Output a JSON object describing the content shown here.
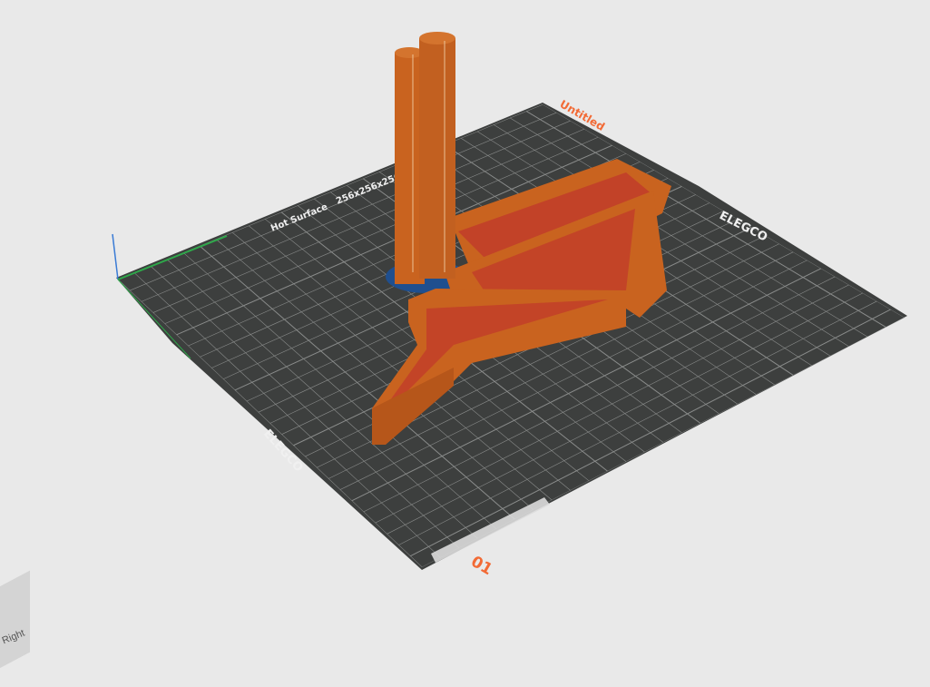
{
  "plate": {
    "name": "Untitled",
    "number": "01",
    "brand_logo": "ELEGCO",
    "warning_text": "Hot Surface",
    "size_text": "256x256x256mm"
  },
  "view_cube": {
    "face_label": "Right"
  },
  "colors": {
    "background": "#e9e9e9",
    "bed": "#3d3f3e",
    "grid": "#8a8c8b",
    "model": "#c9631f",
    "model_infill": "#c0392b",
    "accent": "#f26a35",
    "wipe_base": "#1f4f8f"
  }
}
